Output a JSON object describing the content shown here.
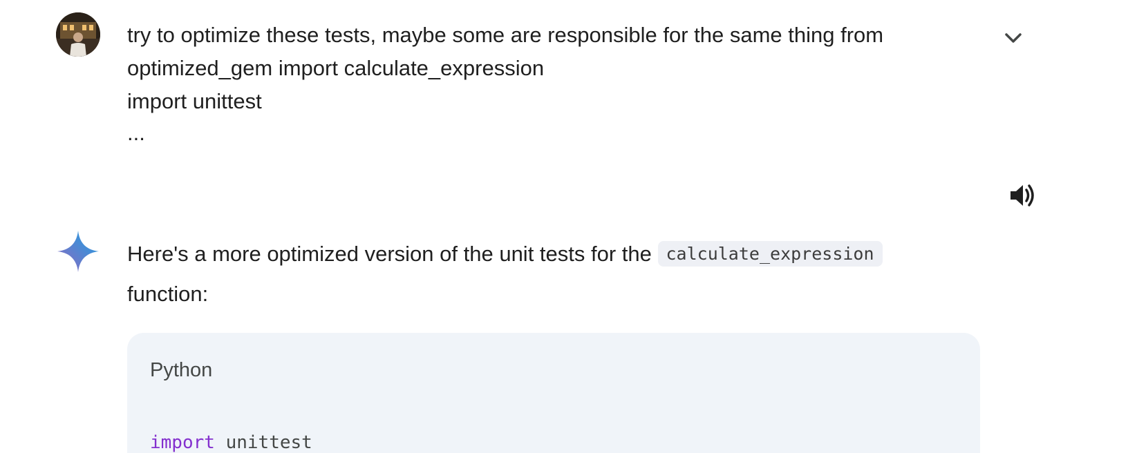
{
  "user_message": {
    "lines": [
      "try to optimize these tests, maybe some are responsible for the same thing from",
      "optimized_gem import calculate_expression",
      "import unittest"
    ],
    "ellipsis": "..."
  },
  "icons": {
    "avatar": "user-avatar",
    "expand": "chevron-down-icon",
    "speaker": "speaker-icon",
    "model": "gemini-sparkle-icon"
  },
  "response": {
    "intro_before": "Here's a more optimized version of the unit tests for the ",
    "inline_code": "calculate_expression",
    "intro_after": "function:"
  },
  "code_block": {
    "language": "Python",
    "line1_keyword": "import",
    "line1_rest": " unittest"
  },
  "colors": {
    "code_bg": "#f0f4f9",
    "inline_code_bg": "#eef0f5",
    "keyword": "#8430ce",
    "text": "#1f1f1f"
  }
}
